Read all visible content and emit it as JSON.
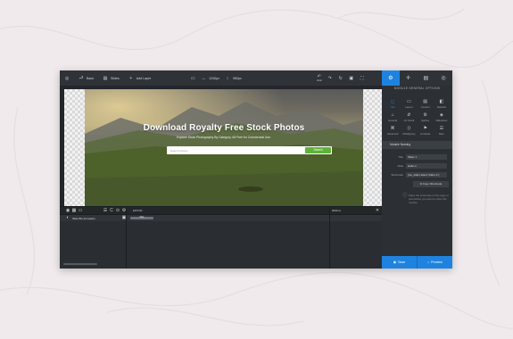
{
  "toolbar": {
    "back_label": "Back",
    "slides_label": "Slides",
    "add_layer_label": "Add Layer",
    "width_value": "1240px",
    "height_value": "960px",
    "undo_label": "Undo"
  },
  "hero": {
    "title": "Download Royalty Free Stock Photos",
    "subtitle": "Explore Stock Photography By Category. All Free for Commercial Use.",
    "search_placeholder": "Search photos",
    "search_button": "Search"
  },
  "timeline": {
    "layer_name": "Slide BG Animation",
    "marker_label": "EDITOR",
    "end_label": "9000ms",
    "bar_label": "Slide"
  },
  "right_panel": {
    "heading": "MODULE GENERAL OPTIONS",
    "options": [
      {
        "icon": "◻",
        "label": "Title"
      },
      {
        "icon": "▭",
        "label": "Layout"
      },
      {
        "icon": "▤",
        "label": "Content"
      },
      {
        "icon": "◧",
        "label": "Defaults"
      },
      {
        "icon": "⌂",
        "label": "General"
      },
      {
        "icon": "⇵",
        "label": "On Scroll"
      },
      {
        "icon": "⚙",
        "label": "Sprites"
      },
      {
        "icon": "◈",
        "label": "Slideshow"
      },
      {
        "icon": "⌘",
        "label": "Advanced"
      },
      {
        "icon": "⟨⟩",
        "label": "CSS/jQuery"
      },
      {
        "icon": "⚑",
        "label": "Art Mode"
      },
      {
        "icon": "☰",
        "label": "Misc"
      }
    ],
    "section_title": "Module Naming",
    "fields": [
      {
        "label": "Title",
        "value": "Slider 1"
      },
      {
        "label": "Alias",
        "value": "slider-1"
      },
      {
        "label": "Shortcode",
        "value": "[rev_slider alias=\"slider-1\"]"
      }
    ],
    "copy_button": "Copy Shortcode",
    "note": "Place the shortcode on the page or post where you want to show this module.",
    "save_label": "Save",
    "preview_label": "Preview"
  },
  "colors": {
    "accent": "#1e83e0",
    "search_button": "#5fb33b",
    "background": "#f0eaec"
  }
}
